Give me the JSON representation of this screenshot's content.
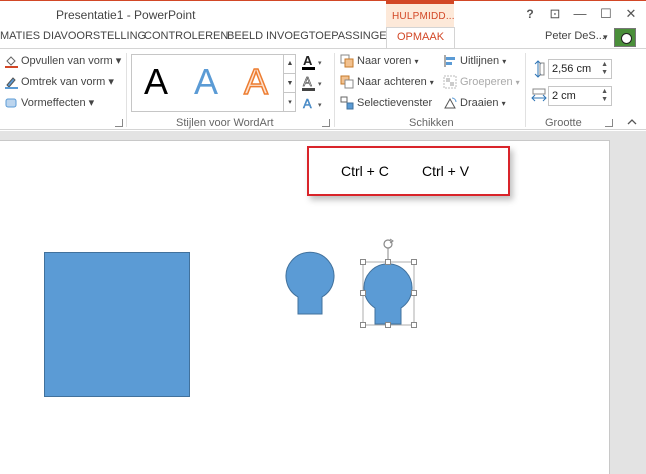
{
  "titlebar": {
    "title": "Presentatie1 - PowerPoint",
    "context_tab": "HULPMIDD...",
    "help": "?",
    "ribbon_display": "⊡",
    "minimize": "—",
    "restore": "☐",
    "close": "✕"
  },
  "tabs": [
    {
      "label": "MATIES"
    },
    {
      "label": "DIAVOORSTELLING"
    },
    {
      "label": "CONTROLEREN"
    },
    {
      "label": "BEELD"
    },
    {
      "label": "INVOEGTOEPASSINGEN"
    },
    {
      "label": "OPMAAK"
    }
  ],
  "user": {
    "name": "Peter DeS...",
    "dropdown": "▾"
  },
  "ribbon": {
    "shape_styles": {
      "fill": "Opvullen van vorm",
      "outline": "Omtrek van vorm",
      "effects": "Vormeffecten"
    },
    "wordart": {
      "group_label": "Stijlen voor WordArt",
      "letters": [
        "A",
        "A",
        "A"
      ]
    },
    "arrange": {
      "group_label": "Schikken",
      "bring_forward": "Naar voren",
      "send_backward": "Naar achteren",
      "selection_pane": "Selectievenster",
      "align": "Uitlijnen",
      "group": "Groeperen",
      "rotate": "Draaien"
    },
    "size": {
      "group_label": "Grootte",
      "height": "2,56 cm",
      "width": "2 cm"
    }
  },
  "callout": {
    "copy": "Ctrl + C",
    "paste": "Ctrl + V"
  },
  "colors": {
    "accent": "#d24726",
    "shape_fill": "#5b9bd5",
    "shape_border": "#41719c",
    "callout_border": "#d9242a"
  }
}
